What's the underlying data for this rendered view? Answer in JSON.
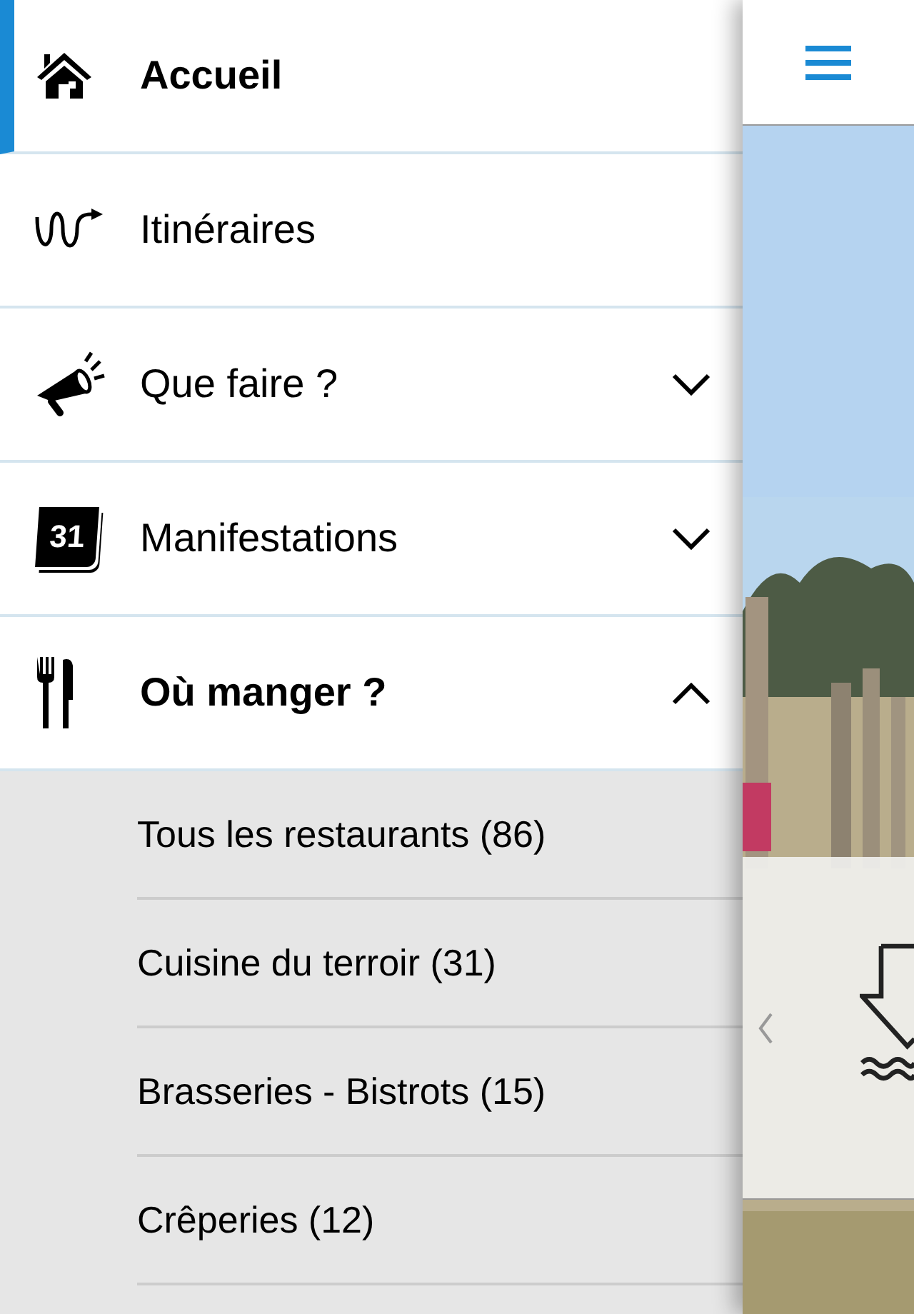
{
  "menu": [
    {
      "label": "Accueil",
      "selected": true
    },
    {
      "label": "Itinéraires",
      "selected": false
    },
    {
      "label": "Que faire ?",
      "selected": false,
      "expanded": false
    },
    {
      "label": "Manifestations",
      "selected": false,
      "expanded": false,
      "icon_text": "31"
    },
    {
      "label": "Où manger ?",
      "selected": false,
      "expanded": true,
      "children": [
        {
          "label": "Tous les restaurants (86)"
        },
        {
          "label": "Cuisine du terroir (31)"
        },
        {
          "label": "Brasseries - Bistrots (15)"
        },
        {
          "label": "Crêperies (12)"
        }
      ]
    }
  ]
}
